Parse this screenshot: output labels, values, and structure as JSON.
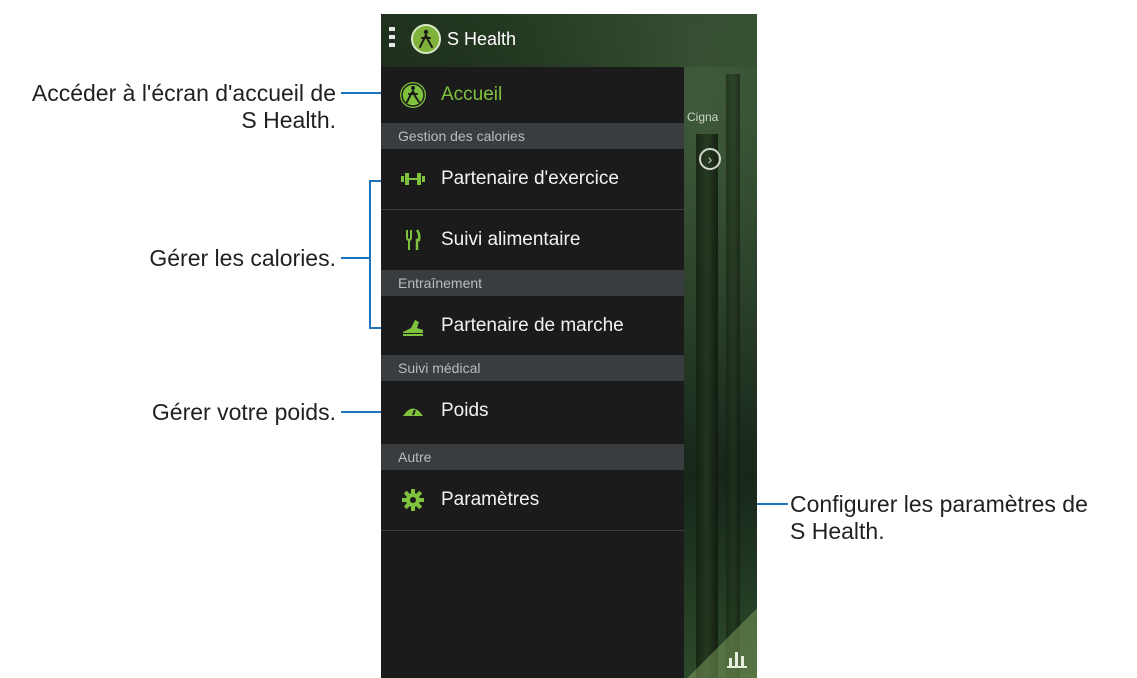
{
  "app": {
    "title": "S Health"
  },
  "drawer": {
    "home": {
      "label": "Accueil"
    },
    "sections": [
      {
        "header": "Gestion des calories"
      },
      {
        "header": "Entraînement"
      },
      {
        "header": "Suivi médical"
      },
      {
        "header": "Autre"
      }
    ],
    "items": [
      {
        "label": "Partenaire d'exercice",
        "icon": "dumbbell-icon"
      },
      {
        "label": "Suivi alimentaire",
        "icon": "fork-knife-icon"
      },
      {
        "label": "Partenaire de marche",
        "icon": "walking-shoe-icon"
      },
      {
        "label": "Poids",
        "icon": "weight-scale-icon"
      },
      {
        "label": "Paramètres",
        "icon": "gear-icon"
      }
    ]
  },
  "background_content": {
    "partial_text": "Cigna"
  },
  "callouts": {
    "home": {
      "line1": "Accéder à l'écran d'accueil de",
      "line2": "S Health."
    },
    "calories": {
      "text": "Gérer les calories."
    },
    "weight": {
      "text": "Gérer votre poids."
    },
    "settings": {
      "line1": "Configurer les paramètres de",
      "line2": "S Health."
    }
  },
  "colors": {
    "accent_green": "#7fc23d",
    "callout_line": "#1c75bc"
  }
}
